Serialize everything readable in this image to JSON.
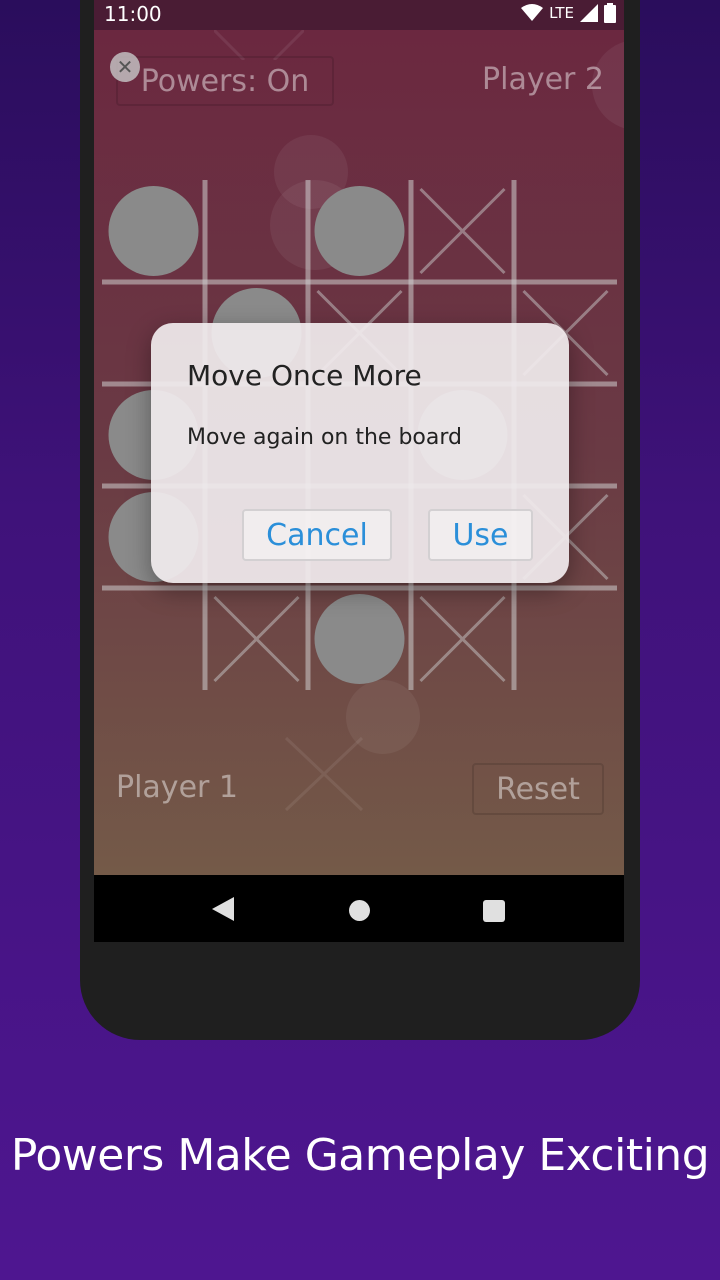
{
  "status": {
    "time": "11:00",
    "network": "LTE"
  },
  "game": {
    "powers_label": "Powers: On",
    "player2_label": "Player 2",
    "player1_label": "Player 1",
    "reset_label": "Reset",
    "close_glyph": "✕"
  },
  "board": {
    "cells": [
      [
        "O",
        "",
        "O",
        "X",
        ""
      ],
      [
        "",
        "O",
        "X",
        "",
        "X"
      ],
      [
        "O",
        "",
        "",
        "O",
        ""
      ],
      [
        "O",
        "",
        "",
        "",
        "X"
      ],
      [
        "",
        "X",
        "O",
        "X",
        ""
      ]
    ]
  },
  "dialog": {
    "title": "Move Once More",
    "message": "Move again on the board",
    "cancel_label": "Cancel",
    "use_label": "Use"
  },
  "caption": "Powers Make Gameplay Exciting",
  "colors": {
    "bg_top": "#2a0d5c",
    "bg_bottom": "#4e1690",
    "accent": "#2b8fd9",
    "piece": "#8a8a8a"
  }
}
